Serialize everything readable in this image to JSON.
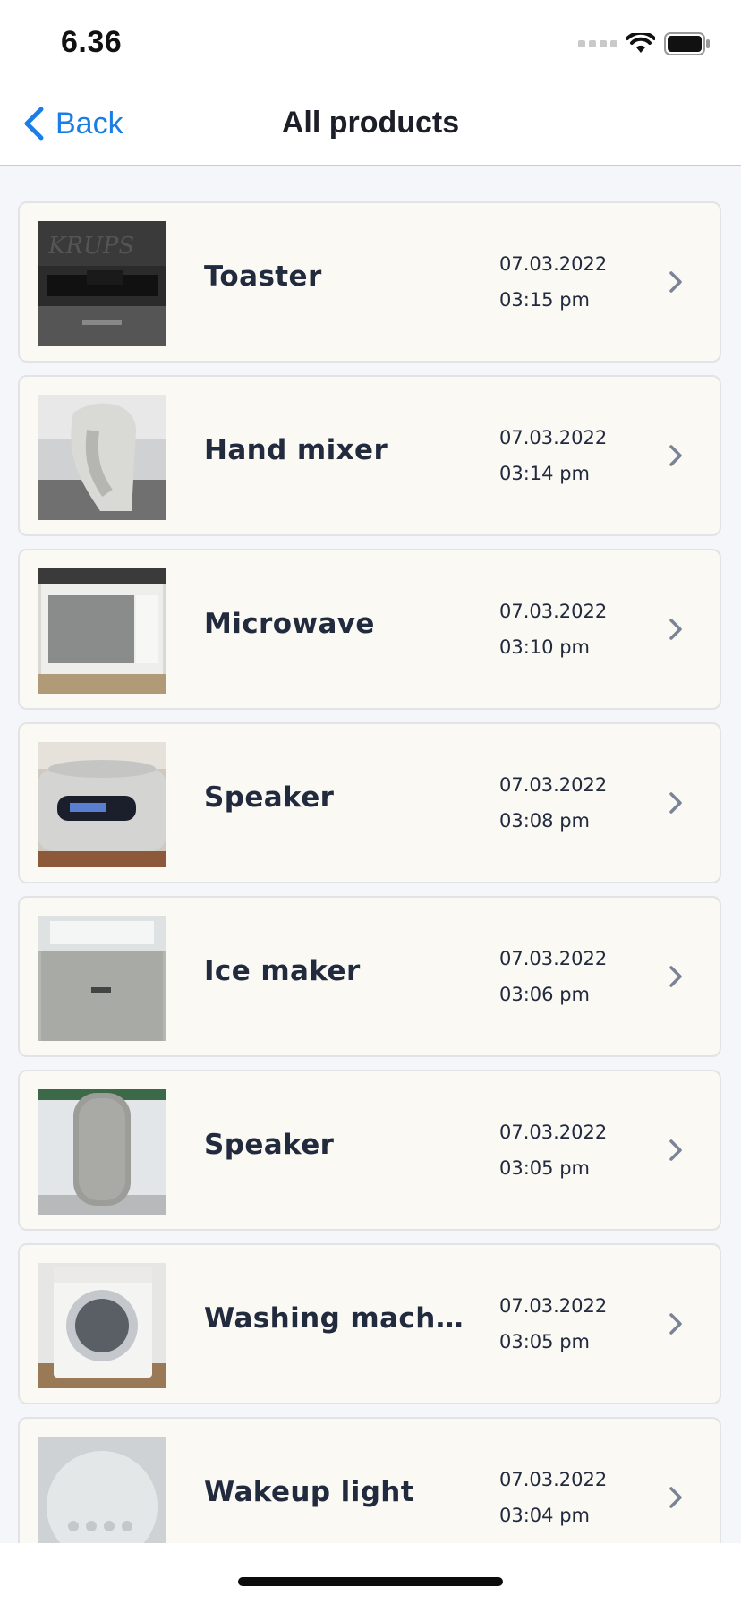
{
  "status_bar": {
    "time": "6.36",
    "icons": [
      "cellular-signal-icon",
      "wifi-icon",
      "battery-icon"
    ]
  },
  "nav": {
    "back_label": "Back",
    "title": "All products"
  },
  "products": [
    {
      "name": "Toaster",
      "date": "07.03.2022",
      "time": "03:15 pm",
      "thumb": "toaster"
    },
    {
      "name": "Hand mixer",
      "date": "07.03.2022",
      "time": "03:14 pm",
      "thumb": "mixer"
    },
    {
      "name": "Microwave",
      "date": "07.03.2022",
      "time": "03:10 pm",
      "thumb": "microwave"
    },
    {
      "name": "Speaker",
      "date": "07.03.2022",
      "time": "03:08 pm",
      "thumb": "speaker-box"
    },
    {
      "name": "Ice maker",
      "date": "07.03.2022",
      "time": "03:06 pm",
      "thumb": "icemaker"
    },
    {
      "name": "Speaker",
      "date": "07.03.2022",
      "time": "03:05 pm",
      "thumb": "speaker-cyl"
    },
    {
      "name": "Washing machi...",
      "date": "07.03.2022",
      "time": "03:05 pm",
      "thumb": "washer"
    },
    {
      "name": "Wakeup light",
      "date": "07.03.2022",
      "time": "03:04 pm",
      "thumb": "lamp"
    }
  ],
  "colors": {
    "accent": "#1a7ee6",
    "text": "#222a3e",
    "card": "#faf9f4",
    "background": "#f4f6f9"
  }
}
